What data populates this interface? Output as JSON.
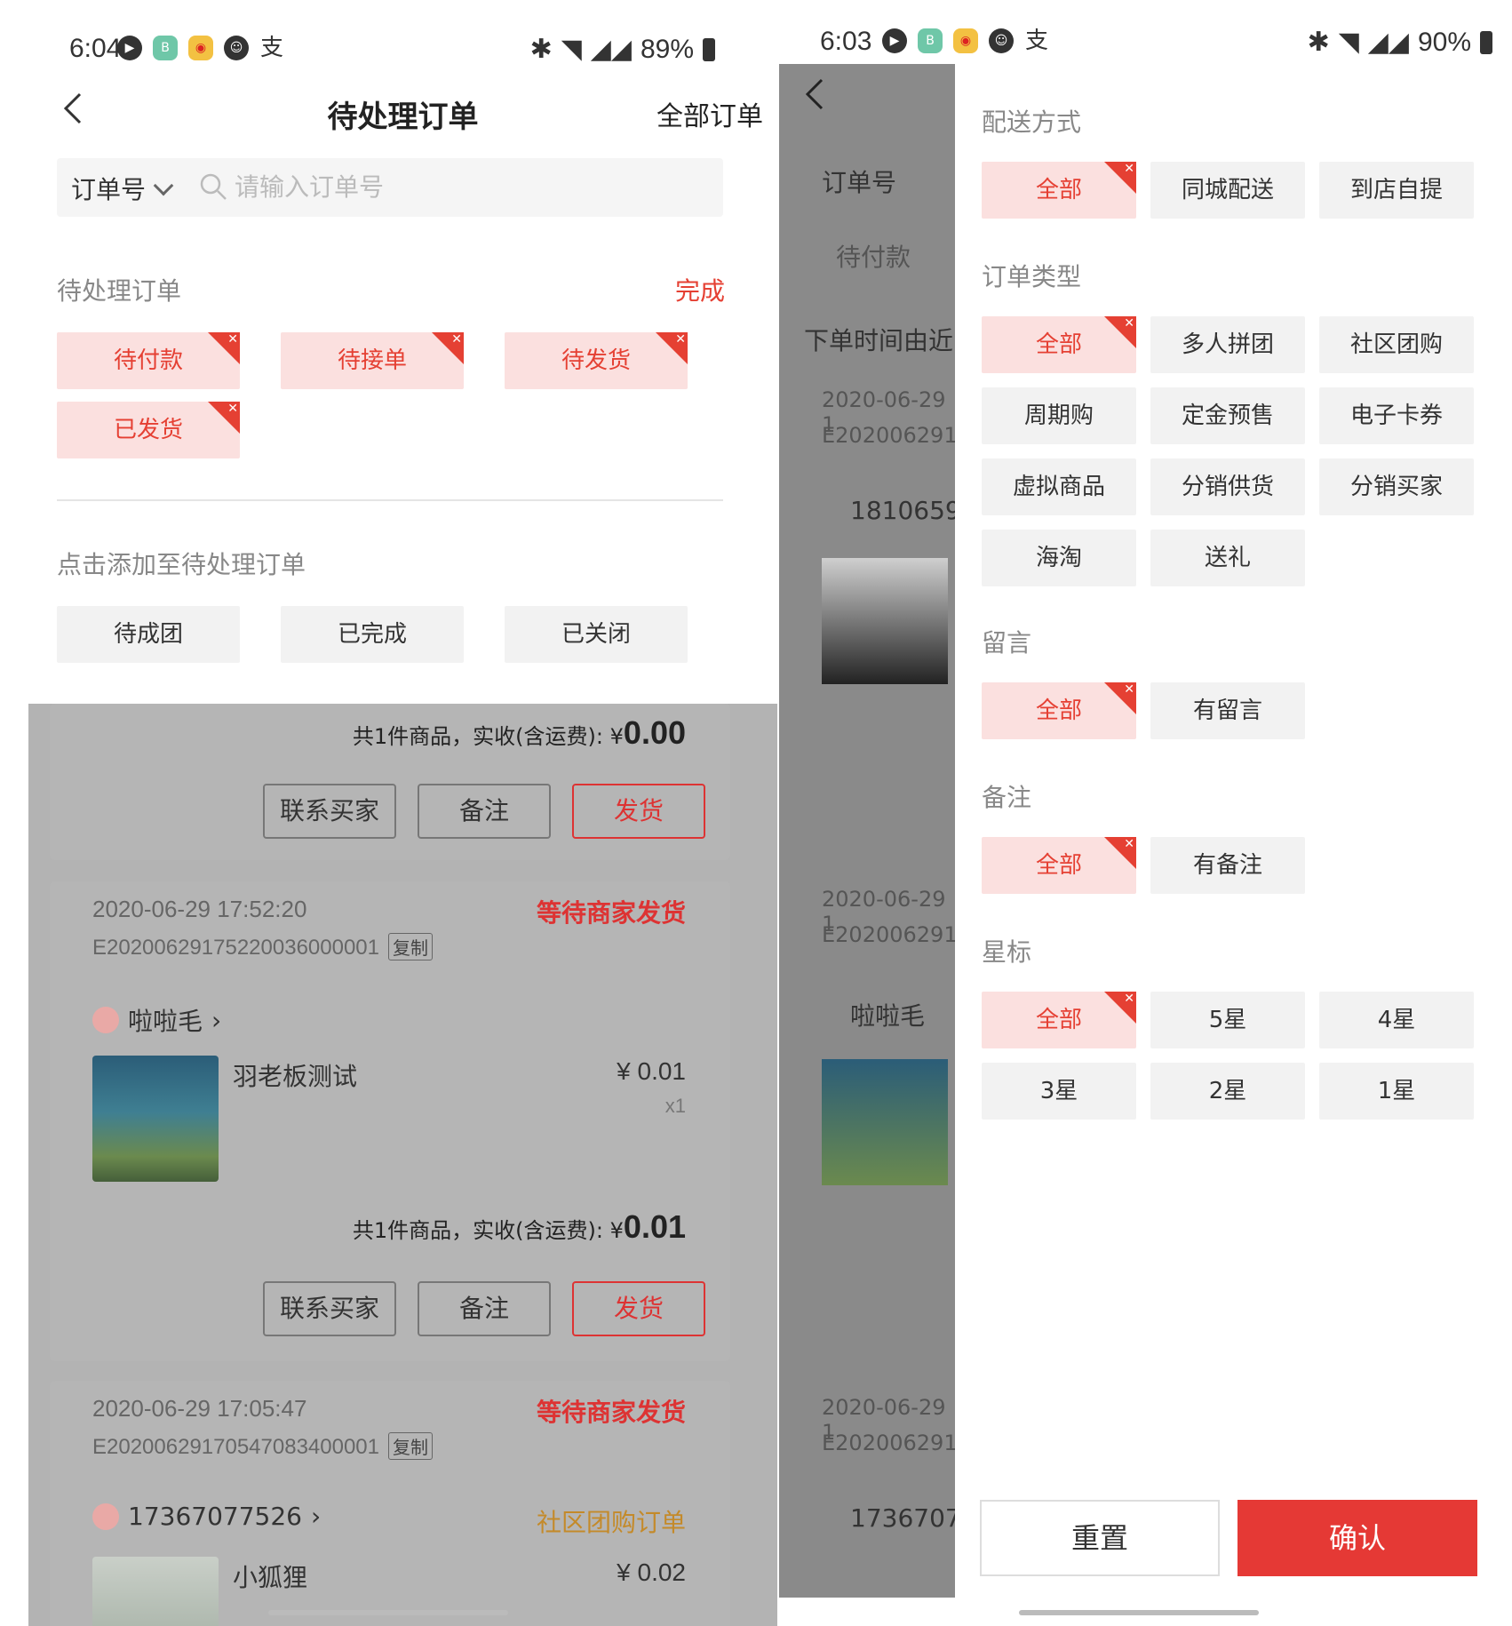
{
  "left": {
    "status": {
      "time": "6:04",
      "battery": "89%"
    },
    "nav": {
      "title": "待处理订单",
      "right": "全部订单"
    },
    "search": {
      "type": "订单号",
      "placeholder": "请输入订单号"
    },
    "pending": {
      "title": "待处理订单",
      "done": "完成",
      "chips": [
        "待付款",
        "待接单",
        "待发货",
        "已发货"
      ]
    },
    "add": {
      "title": "点击添加至待处理订单",
      "chips": [
        "待成团",
        "已完成",
        "已关闭"
      ]
    },
    "orders": [
      {
        "total_label": "共1件商品，实收(含运费):",
        "total_currency": "¥",
        "total_value": "0.00",
        "buttons": [
          "联系买家",
          "备注",
          "发货"
        ]
      },
      {
        "date": "2020-06-29 17:52:20",
        "status": "等待商家发货",
        "order_no": "E20200629175220036000001",
        "copy": "复制",
        "buyer": "啦啦毛",
        "product": "羽老板测试",
        "price": "¥ 0.01",
        "qty": "x1",
        "total_label": "共1件商品，实收(含运费):",
        "total_currency": "¥",
        "total_value": "0.01",
        "buttons": [
          "联系买家",
          "备注",
          "发货"
        ]
      },
      {
        "date": "2020-06-29 17:05:47",
        "status": "等待商家发货",
        "order_no": "E20200629170547083400001",
        "copy": "复制",
        "buyer": "17367077526",
        "tag": "社区团购订单",
        "product": "小狐狸",
        "price": "¥ 0.02"
      }
    ]
  },
  "right": {
    "status": {
      "time": "6:03",
      "battery": "90%"
    },
    "background": {
      "search_type": "订单号",
      "tab": "待付款",
      "sort": "下单时间由近",
      "date1": "2020-06-29 1",
      "no1": "E202006291",
      "phone1": "1810659",
      "date2": "2020-06-29 1",
      "no2": "E202006291",
      "buyer2": "啦啦毛",
      "date3": "2020-06-29 1",
      "no3": "E202006291",
      "phone3": "1736707"
    },
    "filters": {
      "delivery": {
        "title": "配送方式",
        "options": [
          "全部",
          "同城配送",
          "到店自提"
        ]
      },
      "order_type": {
        "title": "订单类型",
        "options": [
          "全部",
          "多人拼团",
          "社区团购",
          "周期购",
          "定金预售",
          "电子卡券",
          "虚拟商品",
          "分销供货",
          "分销买家",
          "海淘",
          "送礼"
        ]
      },
      "message": {
        "title": "留言",
        "options": [
          "全部",
          "有留言"
        ]
      },
      "remark": {
        "title": "备注",
        "options": [
          "全部",
          "有备注"
        ]
      },
      "star": {
        "title": "星标",
        "options": [
          "全部",
          "5星",
          "4星",
          "3星",
          "2星",
          "1星"
        ]
      }
    },
    "reset": "重置",
    "confirm": "确认"
  },
  "colors": {
    "accent": "#e54033",
    "chip_selected_bg": "#fbe0df",
    "chip_bg": "#f2f2f2",
    "confirm": "#e53935"
  }
}
